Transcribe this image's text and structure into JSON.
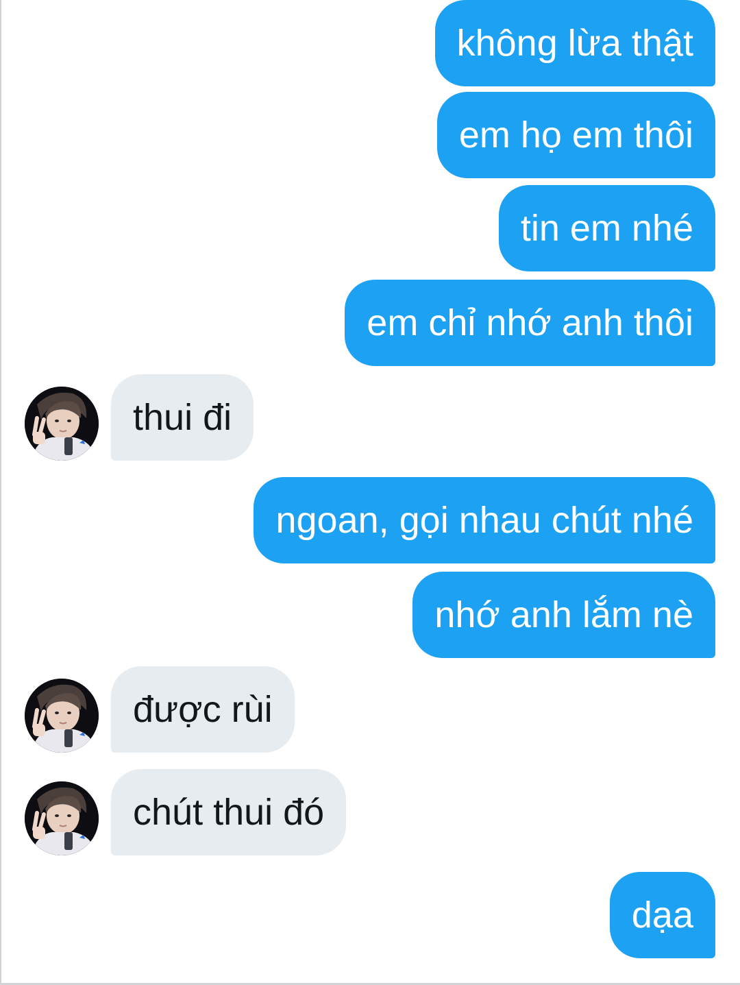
{
  "conversation": {
    "messages": [
      {
        "direction": "sent",
        "text": "không lừa thật"
      },
      {
        "direction": "sent",
        "text": "em họ em thôi"
      },
      {
        "direction": "sent",
        "text": "tin em nhé"
      },
      {
        "direction": "sent",
        "text": "em chỉ nhớ anh thôi"
      },
      {
        "direction": "received",
        "text": "thui đi",
        "avatar": "user-avatar-photo"
      },
      {
        "direction": "sent",
        "text": "ngoan, gọi nhau chút nhé"
      },
      {
        "direction": "sent",
        "text": "nhớ anh lắm nè"
      },
      {
        "direction": "received",
        "text": "được rùi",
        "avatar": "user-avatar-photo"
      },
      {
        "direction": "received",
        "text": "chút thui đó",
        "avatar": "user-avatar-photo"
      },
      {
        "direction": "sent",
        "text": "dạa"
      }
    ]
  },
  "colors": {
    "sent_bubble": "#1da1f2",
    "received_bubble": "#e6ecf0",
    "sent_text": "#ffffff",
    "received_text": "#14171a",
    "background": "#ffffff"
  }
}
